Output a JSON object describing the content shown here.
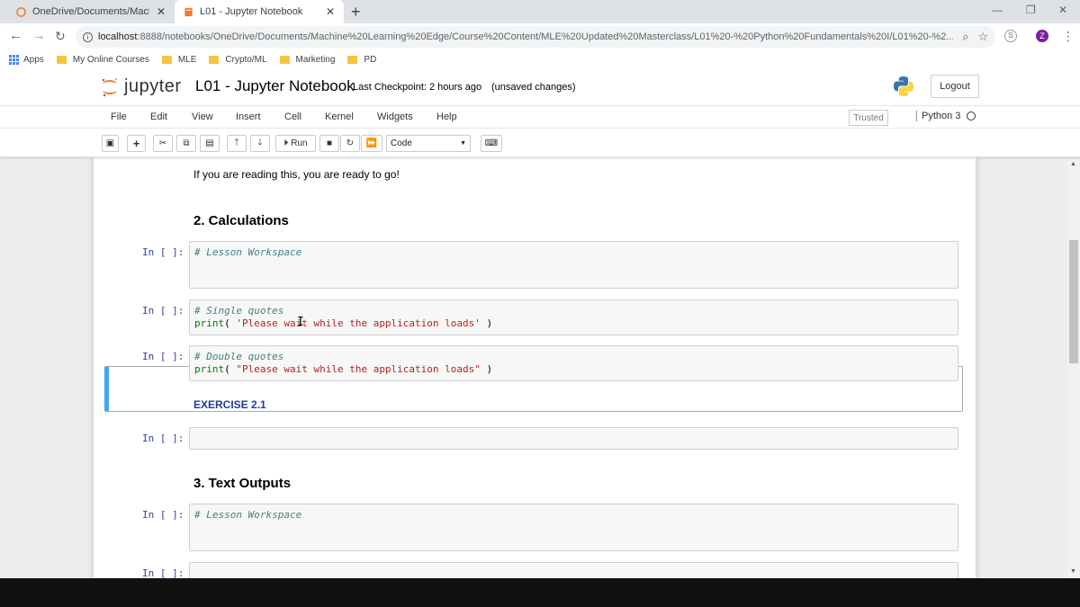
{
  "browser": {
    "tabs": [
      {
        "title": "OneDrive/Documents/Machine L",
        "close": "✕"
      },
      {
        "title": "L01 - Jupyter Notebook",
        "close": "✕"
      }
    ],
    "new_tab": "+",
    "window_controls": {
      "minimize": "—",
      "restore": "❐",
      "close": "✕"
    },
    "url_host": "localhost",
    "url_rest": ":8888/notebooks/OneDrive/Documents/Machine%20Learning%20Edge/Course%20Content/MLE%20Updated%20Masterclass/L01%20-%20Python%20Fundamentals%20I/L01%20-%2...",
    "profile_initial": "Z",
    "bookmarks": [
      "Apps",
      "My Online Courses",
      "MLE",
      "Crypto/ML",
      "Marketing",
      "PD"
    ]
  },
  "jupyter": {
    "logo_text": "jupyter",
    "notebook_name": "L01 - Jupyter Notebook",
    "checkpoint": "Last Checkpoint: 2 hours ago",
    "unsaved": "(unsaved changes)",
    "logout": "Logout",
    "menu": [
      "File",
      "Edit",
      "View",
      "Insert",
      "Cell",
      "Kernel",
      "Widgets",
      "Help"
    ],
    "trusted": "Trusted",
    "kernel": "Python 3",
    "toolbar": {
      "run_label": "Run",
      "cell_type": "Code"
    }
  },
  "notebook": {
    "intro_text": "If you are reading this, you are ready to go!",
    "heading_calc": "2. Calculations",
    "heading_text": "3. Text Outputs",
    "exercise": "EXERCISE 2.1",
    "prompt": "In [ ]:",
    "cells": [
      {
        "comment": "# Lesson Workspace"
      },
      {
        "comment": "# Single quotes",
        "fn": "print",
        "open": "( ",
        "string": "'Please wait while the application loads'",
        "close": " )"
      },
      {
        "comment": "# Double quotes",
        "fn": "print",
        "open": "( ",
        "string": "\"Please wait while the application loads\"",
        "close": " )"
      },
      {
        "comment": ""
      },
      {
        "comment": "# Lesson Workspace"
      }
    ]
  },
  "colors": {
    "accent_selected": "#42a5f5",
    "prompt": "#303f9f",
    "comment": "#408080",
    "string": "#ba2121",
    "builtin": "#008000"
  }
}
